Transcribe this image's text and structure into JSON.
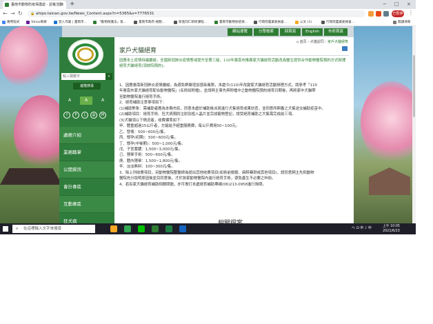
{
  "browser": {
    "tab_title": "臺南市動物防疫保護處 - 認養活動",
    "tab_close": "×",
    "new_tab": "+",
    "window_controls": [
      "−",
      "□",
      "×"
    ],
    "url": "ahipo.tainan.gov.tw/News_Content.aspx?n=5365&s=7776531",
    "profile_label": "已暫停",
    "bookmarks": [
      "應用程式",
      "Yahoo奇摩",
      "登入作業 | 臺南市...",
      "「動物保護法」第...",
      "臺南市政府-規劃...",
      "新進同仁研修課程...",
      "臺南市動物防疫保...",
      "行政院農業委員會...",
      "公文 (1)",
      "行政院農業委員會...",
      "閱讀清單"
    ]
  },
  "topnav": [
    "網站導覽",
    "分眾檢索",
    "回首頁",
    "English",
    "市府首頁"
  ],
  "sidebar": {
    "search_placeholder": "輸入關鍵字",
    "search_icon": "search-icon",
    "adv_search": "進階搜尋",
    "font_sizes": [
      "A",
      "A",
      "A"
    ],
    "social": [
      "f",
      "P",
      "L",
      "@",
      "M"
    ],
    "menu": [
      "處務介紹",
      "業務職掌",
      "公開資訊",
      "會計專區",
      "互動專區",
      "狂犬病"
    ]
  },
  "content": {
    "breadcrumb": [
      "首頁",
      "犬貓認同",
      "家戶犬貓絕育"
    ],
    "title": "家戶犬貓絕育",
    "intro": "因應本土疫情持續嚴峻，全國新冠肺炎疫情警戒提升至第三級，110年臺南市推廣家犬貓絕育活動改為醫生提供合作動物醫院預約方式辦理絕育犬貓絕育(須該院預約)。",
    "lines": [
      "1、因應臺南新冠肺炎疫情嚴峻，為避免群聚增加感染風險，本處今(110)年改變家犬貓絕育活動辦理方式，請參考「110",
      "年臺南市家犬貓絕育配合動物醫院」(名冊如附檔)，並請與主事先與附檔中之動物醫院預約絕育日期後，再將家中犬貓帶",
      "至動物醫院進行絕育手術。",
      "2、絕育補助注意事項如下：",
      "(1)補助對象：需補助者應為本縣市民，同意本處於補助後派員進行犬隻絕育成果訪查，並同意所飼養之犬隻送交補助疫苗中。",
      "(2)補助項目：絕育手術、狂犬病預防注射及植入晶片並完成寵物登記，請受絕育補助之犬隻需完成前三項。",
      "(3)犬貓須以下情況者，收費標準如下：",
      "甲、體重超過15公斤者，方能給予超重服務費，每公斤費用50~100元。",
      "乙、發情：500~600元/隻。",
      "丙、懷孕(初期)：500~600元/隻。",
      "丁、懷孕(中後期)：500~1,000元/隻。",
      "戊、子宮蓄膿：1,500~3,000元/隻。",
      "己、隱睪手術：500~600元/隻。",
      "庚、體內隱睪：1,500~1,800元/隻。",
      "辛、淡淡無料：100~300元/隻。",
      "3、除上列收費項目，另動物醫院獸醫師為提出其他收費項目(如術前檢驗、麻醉藥劑或其他項目)，請同意飼主先和動物",
      "醫院充分說明原因後並目同意後，才於該家動物醫院內進行絕育手術，避免產生不必要之糾紛。",
      "4、若有家犬貓絕育補助相關問題，亦可撥打本處絕育補助專線(06)213-0958進行詢問。"
    ],
    "next_section": "相關檔案"
  },
  "taskbar": {
    "search_placeholder": "在這裡輸入文字來搜尋",
    "tray": "ヘ ⊡ 中 ♪ 中",
    "time": "上午 10:05",
    "date": "2021/6/23"
  },
  "colors": {
    "green_primary": "#2f7d3c",
    "green_dark": "#1b5e20",
    "intro_text": "#2e7d32",
    "profile_red": "#c62828"
  }
}
